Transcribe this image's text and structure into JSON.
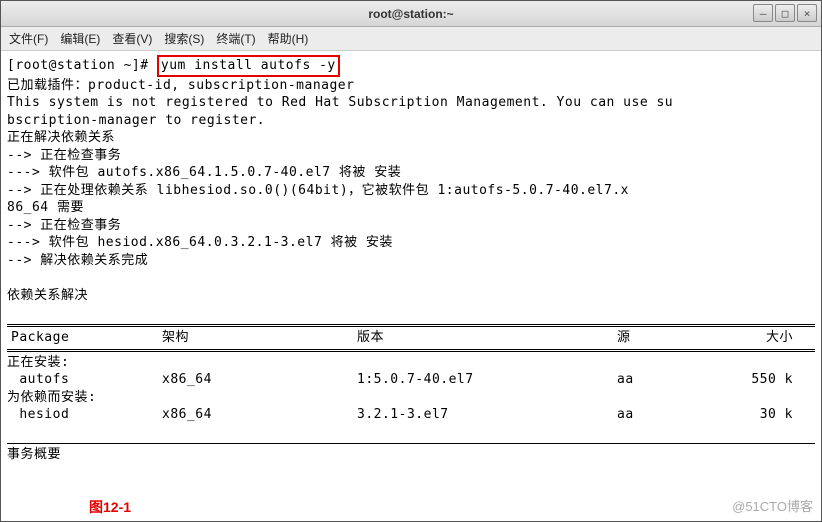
{
  "window": {
    "title": "root@station:~"
  },
  "menu": {
    "items": [
      "文件(F)",
      "编辑(E)",
      "查看(V)",
      "搜索(S)",
      "终端(T)",
      "帮助(H)"
    ]
  },
  "prompt": "[root@station ~]# ",
  "command": "yum install autofs -y",
  "lines": [
    "已加载插件：product-id, subscription-manager",
    "This system is not registered to Red Hat Subscription Management. You can use su",
    "bscription-manager to register.",
    "正在解决依赖关系",
    "--> 正在检查事务",
    "---> 软件包 autofs.x86_64.1.5.0.7-40.el7 将被 安装",
    "--> 正在处理依赖关系 libhesiod.so.0()(64bit)，它被软件包 1:autofs-5.0.7-40.el7.x",
    "86_64 需要",
    "--> 正在检查事务",
    "---> 软件包 hesiod.x86_64.0.3.2.1-3.el7 将被 安装",
    "--> 解决依赖关系完成",
    "",
    "依赖关系解决",
    ""
  ],
  "table": {
    "headers": [
      "Package",
      "架构",
      "版本",
      "源",
      "大小"
    ],
    "sections": [
      {
        "label": "正在安装:",
        "rows": [
          {
            "pkg": " autofs",
            "arch": "x86_64",
            "ver": "1:5.0.7-40.el7",
            "src": "aa",
            "size": "550 k"
          }
        ]
      },
      {
        "label": "为依赖而安装:",
        "rows": [
          {
            "pkg": " hesiod",
            "arch": "x86_64",
            "ver": "3.2.1-3.el7",
            "src": "aa",
            "size": "30 k"
          }
        ]
      }
    ],
    "footer": "事务概要"
  },
  "figure_label": "图12-1",
  "watermark": "@51CTO博客"
}
